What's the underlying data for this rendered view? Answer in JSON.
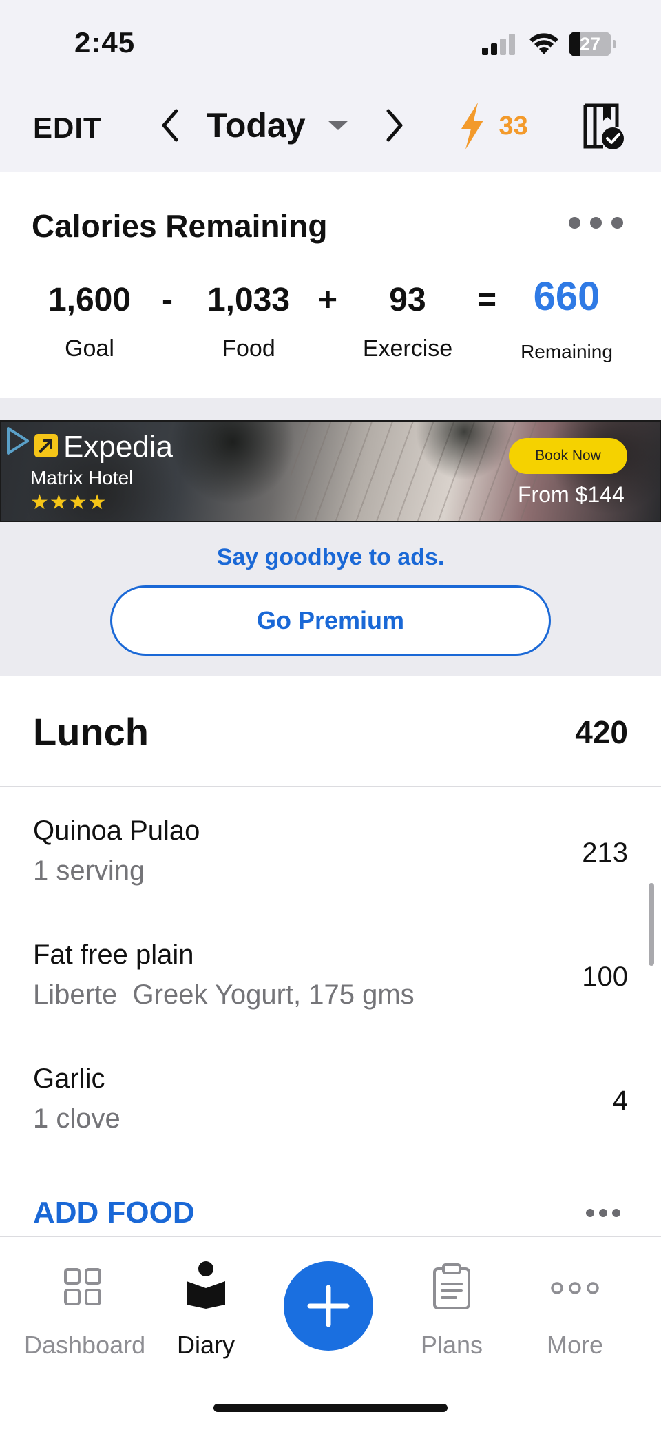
{
  "status_bar": {
    "time": "2:45",
    "battery_level": "27",
    "battery_fraction": 0.27
  },
  "top_nav": {
    "edit_label": "EDIT",
    "date_label": "Today",
    "streak_count": "33",
    "streak_color": "#f39a2b"
  },
  "calories": {
    "title": "Calories Remaining",
    "goal_value": "1,600",
    "goal_label": "Goal",
    "minus_op": "-",
    "food_value": "1,033",
    "food_label": "Food",
    "plus_op": "+",
    "exercise_value": "93",
    "exercise_label": "Exercise",
    "equals_op": "=",
    "remaining_value": "660",
    "remaining_label": "Remaining",
    "remaining_color": "#2f7ae5"
  },
  "ad": {
    "brand": "Expedia",
    "subtitle": "Matrix Hotel",
    "stars": "★★★★",
    "cta": "Book Now",
    "price": "From $144",
    "premium_text": "Say goodbye to ads.",
    "premium_button": "Go Premium",
    "accent_color": "#1a68d6"
  },
  "meal": {
    "title": "Lunch",
    "total": "420",
    "items": [
      {
        "name": "Quinoa Pulao",
        "serving": "1 serving",
        "calories": "213"
      },
      {
        "name": "Fat free plain",
        "serving": "Liberte  Greek Yogurt, 175 gms",
        "calories": "100"
      },
      {
        "name": "Garlic",
        "serving": "1 clove",
        "calories": "4"
      }
    ],
    "add_food_label": "ADD FOOD"
  },
  "tab_bar": {
    "tabs": [
      {
        "label": "Dashboard",
        "icon": "grid-icon",
        "active": false
      },
      {
        "label": "Diary",
        "icon": "diary-book-icon",
        "active": true
      },
      {
        "label": "Plans",
        "icon": "clipboard-icon",
        "active": false
      },
      {
        "label": "More",
        "icon": "more-dots-icon",
        "active": false
      }
    ],
    "add_icon": "plus-icon",
    "add_color": "#1a6fe0"
  }
}
